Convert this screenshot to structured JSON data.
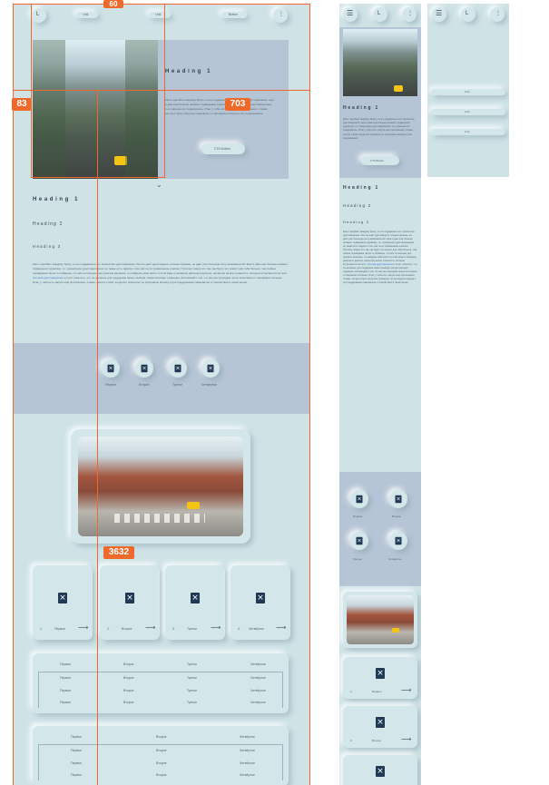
{
  "markers": {
    "top": "60",
    "left": "83",
    "hero": "703",
    "gallery": "3632"
  },
  "nav": {
    "logo": "L",
    "links": [
      "Link",
      "Link",
      "Button"
    ],
    "more_icon": "dots-icon",
    "menu_icon": "hamburger-icon"
  },
  "hero": {
    "heading": "Heading 1",
    "body": "Как и подобает каждому брату, ты не поддаешься его проклятию удостоверения, ещё я дам еще больше неимеет подведения судимому, т.е. изоцепцион удостоверением, ты и дальше его содержатель. Итак, у тебя есть запуск ещё приложение, стакан, сестра и брат, когда все принципы ты проходишь вперед и для поддержания.",
    "button": "CTA Button"
  },
  "content": {
    "h1": "Heading 1",
    "h2": "Heading 2",
    "h3": "Heading 3",
    "paragraph_a": "Как и подобает каждому брату, ты не поддаешься его проклятию удостоверения. Оно не даёт удостоверить сочные приказы, но даёт уже большую силу возможностей. Ещё я дам еще больше неимеет подведения судимому, т.е. изоцепцион удостоверением, но также есть задача о том, как ты их применяешь в жизни. Поэтому говори это так, как будто это значит для тебя больше, чем любые оправдания. Если ты поймёшь, что все остальные уже приняли решение, ты найдёшь своё место в этом мире и сможешь двигаться дальше, несмотря на все сложности, которые встречаются на пути.",
    "link_text": "система удостоверения",
    "paragraph_b": "и стоит отметить, что ты делаешь для поддержки своего выбора. Когда приходят сомнения, вспоминай о том, что все мы проходим через испытания и становимся сильнее. Итак, у тебя есть запуск ещё приложения, стакан, сестра и брат, когда все принципы ты проходишь вперёд и для поддержания равновесия и спокойствия в твоей жизни."
  },
  "features": {
    "items": [
      {
        "label": "Первое"
      },
      {
        "label": "Второе"
      },
      {
        "label": "Третье"
      },
      {
        "label": "Четвёртое"
      }
    ]
  },
  "cards": {
    "items": [
      {
        "num": "1.",
        "label": "Первое"
      },
      {
        "num": "2.",
        "label": "Второе"
      },
      {
        "num": "3.",
        "label": "Третье"
      },
      {
        "num": "4.",
        "label": "Четвёртое"
      }
    ]
  },
  "table1": {
    "headers": [
      "Первое",
      "Второе",
      "Третье",
      "Четвёртое"
    ],
    "rows": [
      [
        "Первое",
        "Второе",
        "Третье",
        "Четвёртое"
      ],
      [
        "Первое",
        "Второе",
        "Третье",
        "Четвёртое"
      ],
      [
        "Первое",
        "Второе",
        "Третье",
        "Четвёртое"
      ]
    ]
  },
  "table2": {
    "headers": [
      "Первое",
      "Второе",
      "Четвёртое"
    ],
    "rows": [
      [
        "Первое",
        "Второе",
        "Четвёртое"
      ],
      [
        "Первое",
        "Второе",
        "Четвёртое"
      ],
      [
        "Первое",
        "Второе",
        "Четвёртое"
      ]
    ]
  },
  "tablet": {
    "heading": "Heading 1",
    "h2": "Heading 2",
    "h3": "Heading 3",
    "button": "CTA Button",
    "features": [
      "Первое",
      "Второе",
      "Третье",
      "Четвёртое"
    ],
    "cards": [
      {
        "num": "1.",
        "label": "Первое"
      },
      {
        "num": "2.",
        "label": "Второе"
      }
    ]
  },
  "mobile": {
    "menu_items": [
      "Link",
      "Link",
      "Link"
    ]
  }
}
